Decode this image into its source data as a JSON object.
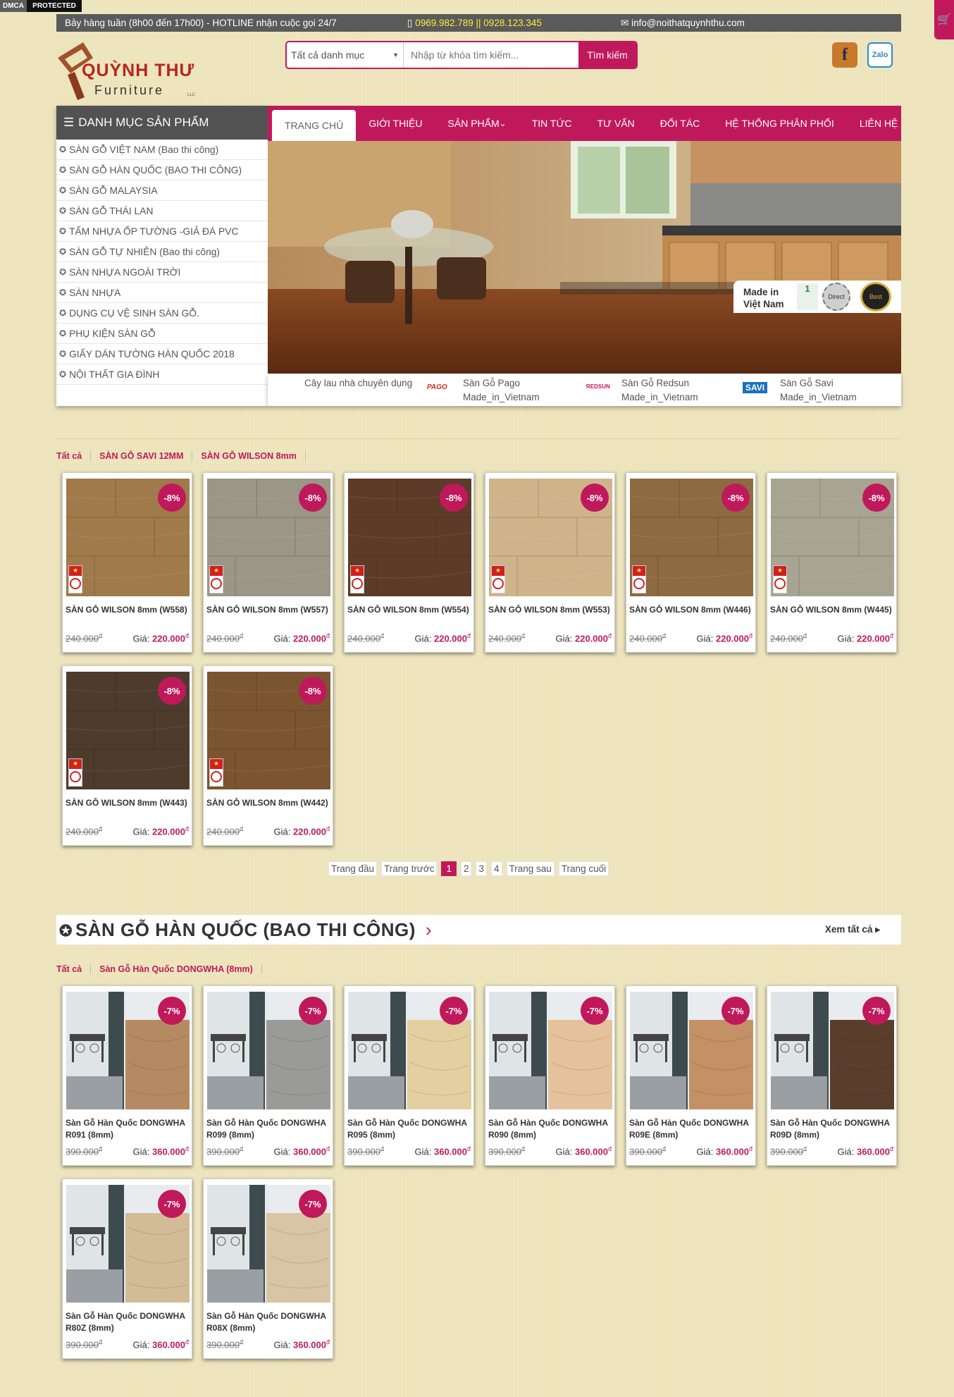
{
  "dmca": {
    "left": "DMCA",
    "right": "PROTECTED"
  },
  "topbar": {
    "hours": "Bảy hàng tuần (8h00 đến 17h00) - HOTLINE nhận cuộc gọi 24/7",
    "phones": "0969.982.789 || 0928.123.345",
    "email": "info@noithatquynhthu.com"
  },
  "logo": {
    "name": "QUỲNH THƯ",
    "sub": "Furniture",
    "llc": "LLC"
  },
  "search": {
    "category": "Tất cả danh mục",
    "placeholder": "Nhập từ khóa tìm kiếm...",
    "button": "Tìm kiếm"
  },
  "social": {
    "fb": "f",
    "zalo": "Zalo"
  },
  "sidebar": {
    "title": "DANH MỤC SẢN PHẨM",
    "items": [
      "SÀN GỖ VIỆT NAM (Bao thi công)",
      "SÀN GỖ HÀN QUỐC (BAO THI CÔNG)",
      "SÀN GỖ MALAYSIA",
      "SÀN GỖ THÁI LAN",
      "TẤM NHỰA ỐP TƯỜNG -GIẢ ĐÁ PVC",
      "SÀN GỖ TỰ NHIÊN (Bao thi công)",
      "SÀN NHỰA NGOÀI TRỜI",
      "SÀN NHỰA",
      "DỤNG CỤ VỆ SINH SÀN GỖ.",
      "PHỤ KIỆN SÀN GỖ",
      "GIẤY DÁN TƯỜNG HÀN QUỐC 2018",
      "NỘI THẤT GIA ĐÌNH"
    ]
  },
  "nav": [
    "TRANG CHỦ",
    "GIỚI THIỆU",
    "SẢN PHẨM",
    "TIN TỨC",
    "TƯ VẤN",
    "ĐỐI TÁC",
    "HỆ THỐNG PHÂN PHỐI",
    "LIÊN HỆ"
  ],
  "banner": {
    "made_in": "Made in",
    "country": "Việt Nam",
    "badge1": "1",
    "badge2": "Direct",
    "badge3": "Best"
  },
  "partners": {
    "p0": "Cây lau nhà chuyên dụng",
    "p1_logo": "PAGO",
    "p1_a": "Sàn Gỗ Pago",
    "p1_b": "Made_in_Vietnam",
    "p2_logo": "REDSUN",
    "p2_a": "Sàn Gỗ Redsun",
    "p2_b": "Made_in_Vietnam",
    "p3_logo": "SAVI",
    "p3_a": "Sàn Gỗ Savi",
    "p3_b": "Made_in_Vietnam"
  },
  "section1": {
    "tabs": [
      "Tất cả",
      "SÀN GỖ SAVI 12MM",
      "SÀN GỖ WILSON 8mm"
    ],
    "products": [
      {
        "name": "SÀN GỖ WILSON 8mm (W558)",
        "old": "240.000",
        "new": "220.000",
        "discount": "-8%",
        "color": "#a07a4a"
      },
      {
        "name": "SÀN GỖ WILSON 8mm (W557)",
        "old": "240.000",
        "new": "220.000",
        "discount": "-8%",
        "color": "#9b9686"
      },
      {
        "name": "SÀN GỖ WILSON 8mm (W554)",
        "old": "240.000",
        "new": "220.000",
        "discount": "-8%",
        "color": "#5d3b28"
      },
      {
        "name": "SÀN GỖ WILSON 8mm (W553)",
        "old": "240.000",
        "new": "220.000",
        "discount": "-8%",
        "color": "#cfb48a"
      },
      {
        "name": "SÀN GỖ WILSON 8mm (W446)",
        "old": "240.000",
        "new": "220.000",
        "discount": "-8%",
        "color": "#8e6a40"
      },
      {
        "name": "SÀN GỖ WILSON 8mm (W445)",
        "old": "240.000",
        "new": "220.000",
        "discount": "-8%",
        "color": "#a8a492"
      },
      {
        "name": "SÀN GỖ WILSON 8mm (W443)",
        "old": "240.000",
        "new": "220.000",
        "discount": "-8%",
        "color": "#4d3b2c"
      },
      {
        "name": "SÀN GỖ WILSON 8mm (W442)",
        "old": "240.000",
        "new": "220.000",
        "discount": "-8%",
        "color": "#7a5530"
      }
    ]
  },
  "pager": [
    "Trang đầu",
    "Trang trước",
    "1",
    "2",
    "3",
    "4",
    "Trang sau",
    "Trang cuối"
  ],
  "section2": {
    "title": "SÀN GỖ HÀN QUỐC (BAO THI CÔNG)",
    "see_all": "Xem tất cả",
    "tabs": [
      "Tất cả",
      "Sàn Gỗ Hàn Quốc DONGWHA (8mm)"
    ],
    "products": [
      {
        "name": "Sàn Gỗ Hàn Quốc DONGWHA R091 (8mm)",
        "old": "390.000",
        "new": "360.000",
        "discount": "-7%",
        "color": "#b58a62"
      },
      {
        "name": "Sàn Gỗ Hàn Quốc DONGWHA R099 (8mm)",
        "old": "390.000",
        "new": "360.000",
        "discount": "-7%",
        "color": "#9a9a98"
      },
      {
        "name": "Sàn Gỗ Hàn Quốc DONGWHA R095 (8mm)",
        "old": "390.000",
        "new": "360.000",
        "discount": "-7%",
        "color": "#e3cfa0"
      },
      {
        "name": "Sàn Gỗ Hàn Quốc DONGWHA R090 (8mm)",
        "old": "390.000",
        "new": "360.000",
        "discount": "-7%",
        "color": "#e6c29c"
      },
      {
        "name": "Sàn Gỗ Hàn Quốc DONGWHA R09E (8mm)",
        "old": "390.000",
        "new": "360.000",
        "discount": "-7%",
        "color": "#c49066"
      },
      {
        "name": "Sàn Gỗ Hàn Quốc DONGWHA R09D (8mm)",
        "old": "390.000",
        "new": "360.000",
        "discount": "-7%",
        "color": "#5b3d2c"
      },
      {
        "name": "Sàn Gỗ Hàn Quốc DONGWHA R80Z (8mm)",
        "old": "390.000",
        "new": "360.000",
        "discount": "-7%",
        "color": "#d2bc98"
      },
      {
        "name": "Sàn Gỗ Hàn Quốc DONGWHA R08X (8mm)",
        "old": "390.000",
        "new": "360.000",
        "discount": "-7%",
        "color": "#d8c5a5"
      }
    ]
  },
  "price_label": "Giá:",
  "currency": "đ"
}
